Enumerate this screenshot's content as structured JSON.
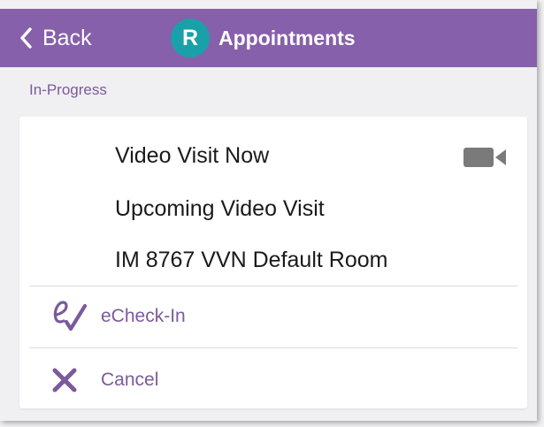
{
  "nav": {
    "back_label": "Back",
    "logo_letter": "R",
    "title": "Appointments"
  },
  "section": {
    "header": "In-Progress"
  },
  "appointment": {
    "line1": "Video Visit Now",
    "line2": "Upcoming Video Visit",
    "line3": "IM 8767 VVN Default Room",
    "status_icon": "video-camera-icon"
  },
  "actions": [
    {
      "label": "eCheck-In",
      "icon": "echeck-in-icon"
    },
    {
      "label": "Cancel",
      "icon": "close-icon"
    }
  ],
  "colors": {
    "nav_bg": "#8660aa",
    "logo_bg": "#1aa0a8",
    "accent": "#7b5a9c",
    "page_bg": "#f0eff2",
    "card_bg": "#ffffff"
  }
}
